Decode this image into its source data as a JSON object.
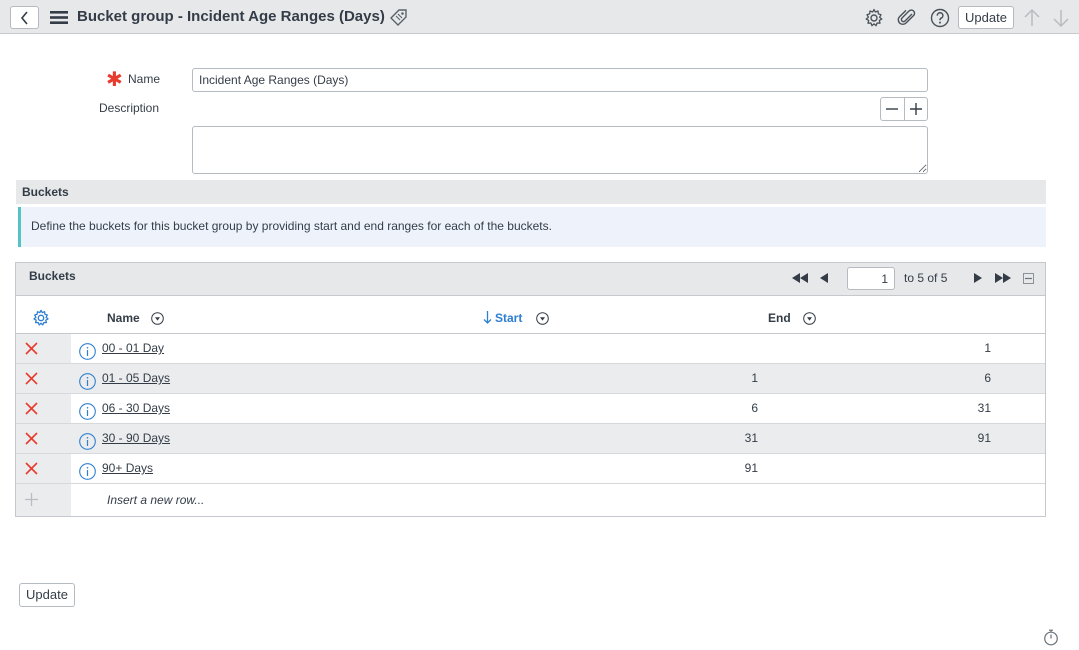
{
  "header": {
    "title": "Bucket group - Incident Age Ranges (Days)",
    "update_label": "Update"
  },
  "form": {
    "name_label": "Name",
    "name_value": "Incident Age Ranges (Days)",
    "description_label": "Description",
    "description_value": ""
  },
  "section": {
    "title": "Buckets",
    "info_text": "Define the buckets for this bucket group by providing start and end ranges for each of the buckets."
  },
  "list": {
    "title": "Buckets",
    "page_value": "1",
    "page_range": "to 5 of 5",
    "columns": {
      "name": "Name",
      "start": "Start",
      "end": "End"
    },
    "rows": [
      {
        "name": "00 - 01 Day",
        "start": "",
        "end": "1"
      },
      {
        "name": "01 - 05 Days",
        "start": "1",
        "end": "6"
      },
      {
        "name": "06 - 30 Days",
        "start": "6",
        "end": "31"
      },
      {
        "name": "30 - 90 Days",
        "start": "31",
        "end": "91"
      },
      {
        "name": "90+ Days",
        "start": "91",
        "end": ""
      }
    ],
    "insert_text": "Insert a new row..."
  },
  "footer": {
    "update_label": "Update"
  },
  "colors": {
    "accent_blue": "#2e7fd0",
    "delete_red": "#e83b2e",
    "required_red": "#e83b2e",
    "info_border": "#52c4c4",
    "header_bg": "#e6e8ea"
  },
  "icons": {
    "back": "chevron-left-icon",
    "menu": "hamburger-menu-icon",
    "tag": "tag-icon",
    "settings": "gear-icon",
    "attachment": "paperclip-icon",
    "help": "question-mark-icon",
    "up": "arrow-up-icon",
    "down": "arrow-down-icon",
    "delete": "x-icon",
    "info": "info-icon",
    "insert": "plus-icon",
    "timer": "stopwatch-icon"
  }
}
